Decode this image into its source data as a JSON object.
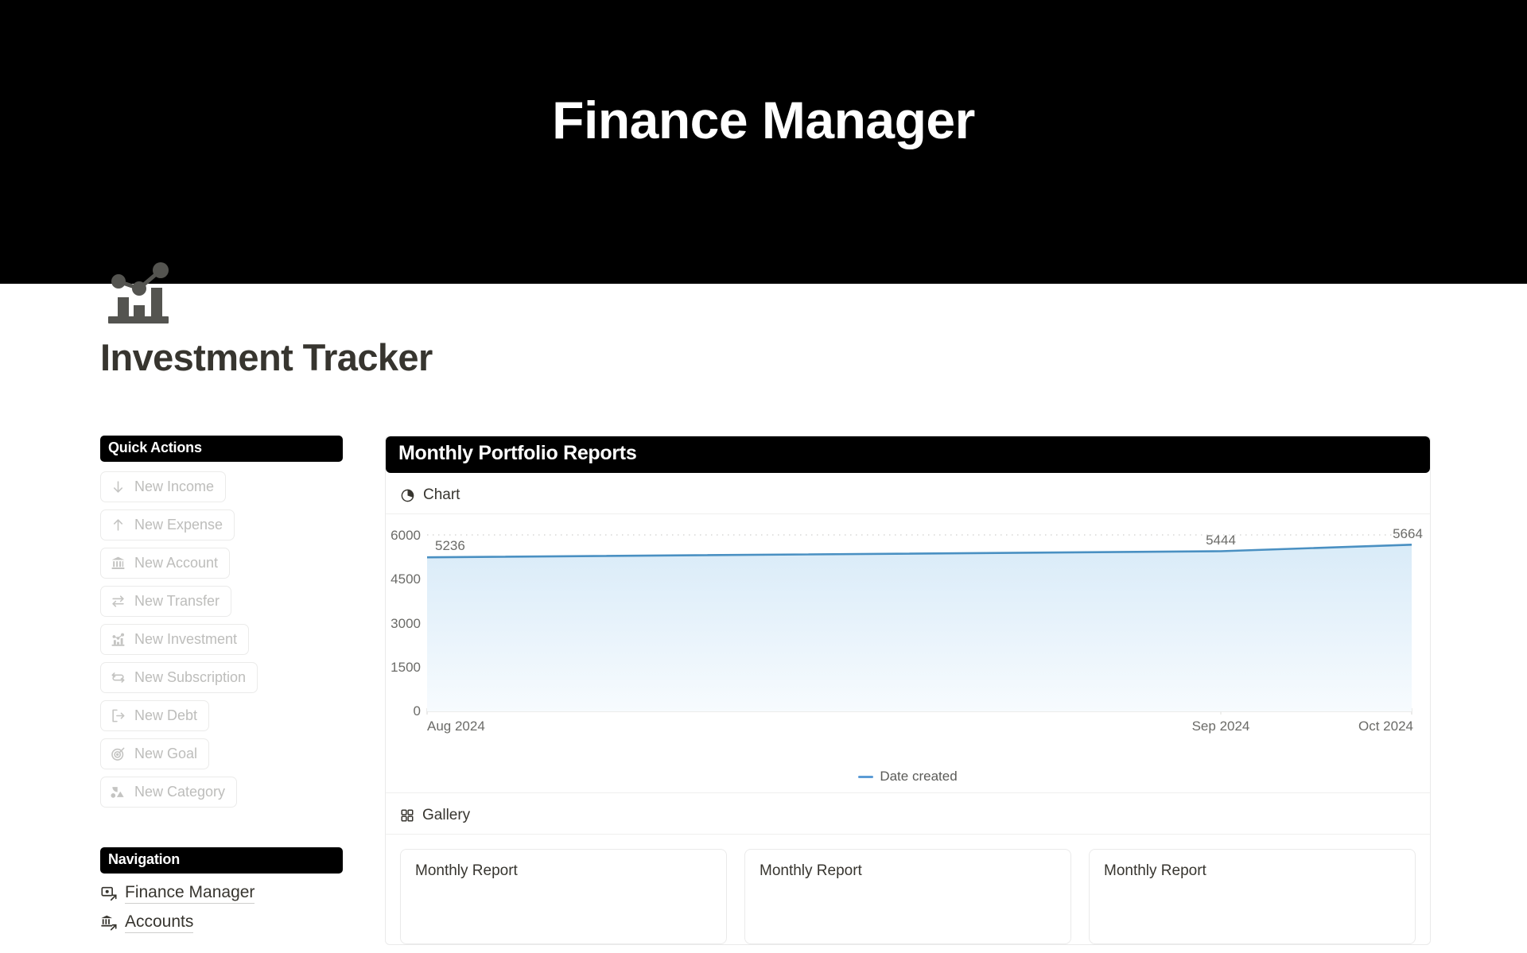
{
  "banner": {
    "title": "Finance Manager",
    "background": "#000000"
  },
  "page": {
    "icon_name": "investment-chart-icon",
    "title": "Investment Tracker"
  },
  "sidebar": {
    "quick_actions": {
      "heading": "Quick Actions",
      "items": [
        {
          "label": "New Income",
          "icon": "arrow-down-icon"
        },
        {
          "label": "New Expense",
          "icon": "arrow-up-icon"
        },
        {
          "label": "New Account",
          "icon": "bank-icon"
        },
        {
          "label": "New Transfer",
          "icon": "transfer-arrows-icon"
        },
        {
          "label": "New Investment",
          "icon": "chart-growth-icon"
        },
        {
          "label": "New Subscription",
          "icon": "refresh-cycle-icon"
        },
        {
          "label": "New Debt",
          "icon": "logout-arrow-icon"
        },
        {
          "label": "New Goal",
          "icon": "target-icon"
        },
        {
          "label": "New Category",
          "icon": "shapes-icon"
        }
      ]
    },
    "navigation": {
      "heading": "Navigation",
      "items": [
        {
          "label": "Finance Manager",
          "icon": "database-link-icon"
        },
        {
          "label": "Accounts",
          "icon": "bank-link-icon"
        }
      ]
    }
  },
  "main": {
    "panel_title": "Monthly Portfolio Reports",
    "views": [
      {
        "label": "Chart",
        "icon": "pie-chart-icon"
      },
      {
        "label": "Gallery",
        "icon": "grid-icon"
      }
    ],
    "gallery": {
      "cards": [
        {
          "title": "Monthly Report"
        },
        {
          "title": "Monthly Report"
        },
        {
          "title": "Monthly Report"
        }
      ]
    }
  },
  "chart_data": {
    "type": "area",
    "title": "",
    "xlabel": "",
    "ylabel": "",
    "x": [
      "Aug 2024",
      "Sep 2024",
      "Oct 2024"
    ],
    "categories": [
      "Aug 2024",
      "Sep 2024",
      "Oct 2024"
    ],
    "values": [
      5236,
      5444,
      5664
    ],
    "data_labels": [
      "5236",
      "5444",
      "5664"
    ],
    "series": [
      {
        "name": "Date created",
        "values": [
          5236,
          5444,
          5664
        ]
      }
    ],
    "ylim": [
      0,
      6000
    ],
    "yticks": [
      0,
      1500,
      3000,
      4500,
      6000
    ],
    "ytick_labels": [
      "0",
      "1500",
      "3000",
      "4500",
      "6000"
    ],
    "xtick_labels": [
      "Aug 2024",
      "Sep 2024",
      "Oct 2024"
    ],
    "grid": true,
    "grid_style": "dotted",
    "legend": {
      "position": "bottom",
      "entries": [
        "Date created"
      ]
    },
    "line_color": "#5b9bd5",
    "fill_color": "#eaf3fb"
  }
}
